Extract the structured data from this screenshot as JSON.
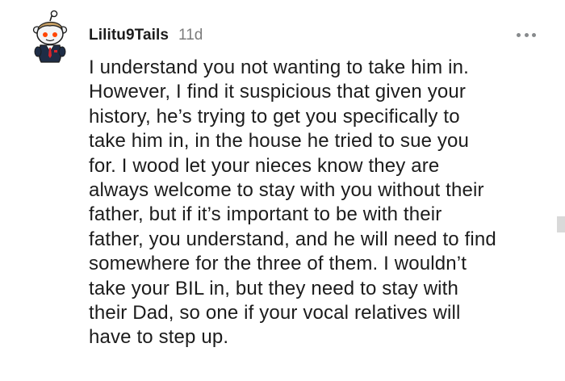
{
  "comment": {
    "avatar_icon": "snoo-avatar-icon",
    "username": "Lilitu9Tails",
    "timestamp": "11d",
    "more_icon": "more-options-icon",
    "body_lines": [
      "I understand you not wanting to take him in.",
      "However, I find it suspicious that given your",
      "history, he’s trying to get you specifically to",
      "take him in, in the house he tried to sue you",
      "for. I wood let your nieces know they are",
      "always welcome to stay with you without their",
      "father, but if it’s important to be with their",
      "father, you understand, and he will need to find",
      "somewhere for the three of them. I wouldn’t",
      "take your BIL in, but they need to stay with",
      "their Dad, so one if your vocal relatives will",
      "have to step up."
    ]
  },
  "colors": {
    "text": "#1c1c1c",
    "meta_text": "#7c7c7c",
    "icon_gray": "#878a8c",
    "background": "#ffffff"
  }
}
